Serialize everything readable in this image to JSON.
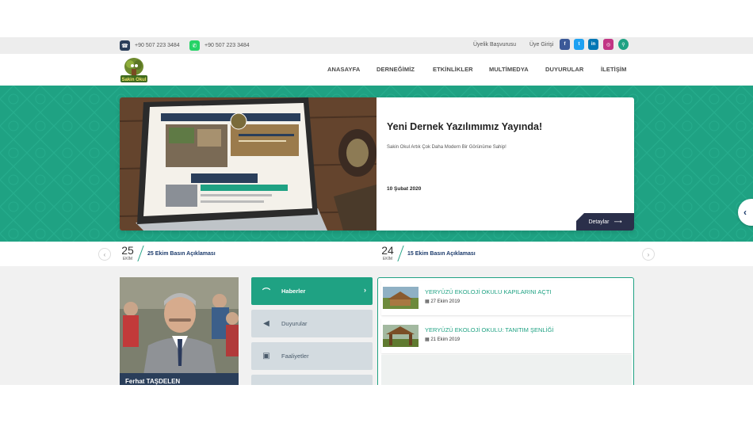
{
  "topbar": {
    "phone": "+90 507 223 3484",
    "whatsapp": "+90 507 223 3484",
    "links": [
      "Üyelik Başvurusu",
      "Üye Girişi"
    ],
    "social": [
      {
        "name": "facebook",
        "glyph": "f",
        "color": "#3b5998"
      },
      {
        "name": "twitter",
        "glyph": "t",
        "color": "#1da1f2"
      },
      {
        "name": "linkedin",
        "glyph": "in",
        "color": "#0077b5"
      },
      {
        "name": "instagram",
        "glyph": "◎",
        "color": "#c13584"
      },
      {
        "name": "search",
        "glyph": "⚲",
        "color": "#1fa283"
      }
    ]
  },
  "header": {
    "logo_text": "Sakin Okul",
    "nav": [
      "ANASAYFA",
      "DERNEĞİMİZ",
      "ETKİNLİKLER",
      "MULTİMEDYA",
      "DUYURULAR",
      "İLETİŞİM"
    ]
  },
  "slider": {
    "title": "Yeni Dernek Yazılımımız Yayında!",
    "subtitle": "Sakin Okul Artık Çok Daha Modern Bir Görünüme Sahip!",
    "date": "10 Şubat 2020",
    "button": "Detaylar",
    "button_arrow": "⟶",
    "prev_arrow": "‹"
  },
  "ticker": {
    "prev": "‹",
    "next": "›",
    "items": [
      {
        "day": "25",
        "month": "EKİM",
        "text": "25 Ekim Basın Açıklaması"
      },
      {
        "day": "24",
        "month": "EKİM",
        "text": "15 Ekim Basın Açıklaması"
      }
    ]
  },
  "profile": {
    "name": "Ferhat TAŞDELEN"
  },
  "tabs": [
    {
      "label": "Haberler",
      "icon": "paperclip-icon",
      "glyph": "⌒",
      "active": true
    },
    {
      "label": "Duyurular",
      "icon": "megaphone-icon",
      "glyph": "◀",
      "active": false
    },
    {
      "label": "Faaliyetler",
      "icon": "briefcase-icon",
      "glyph": "▣",
      "active": false
    },
    {
      "label": "",
      "icon": "document-icon",
      "glyph": "▭",
      "active": false
    }
  ],
  "news": [
    {
      "title": "YERYÜZÜ EKOLOJİ OKULU KAPILARINI AÇTI",
      "date": "27 Ekim 2019",
      "icon": "calendar-icon"
    },
    {
      "title": "YERYÜZÜ EKOLOJİ OKULU: TANITIM ŞENLİĞİ",
      "date": "21 Ekim 2019",
      "icon": "calendar-icon"
    }
  ],
  "colors": {
    "accent": "#1fa283",
    "dark": "#2a2f4a",
    "navy": "#1b3a6b"
  }
}
